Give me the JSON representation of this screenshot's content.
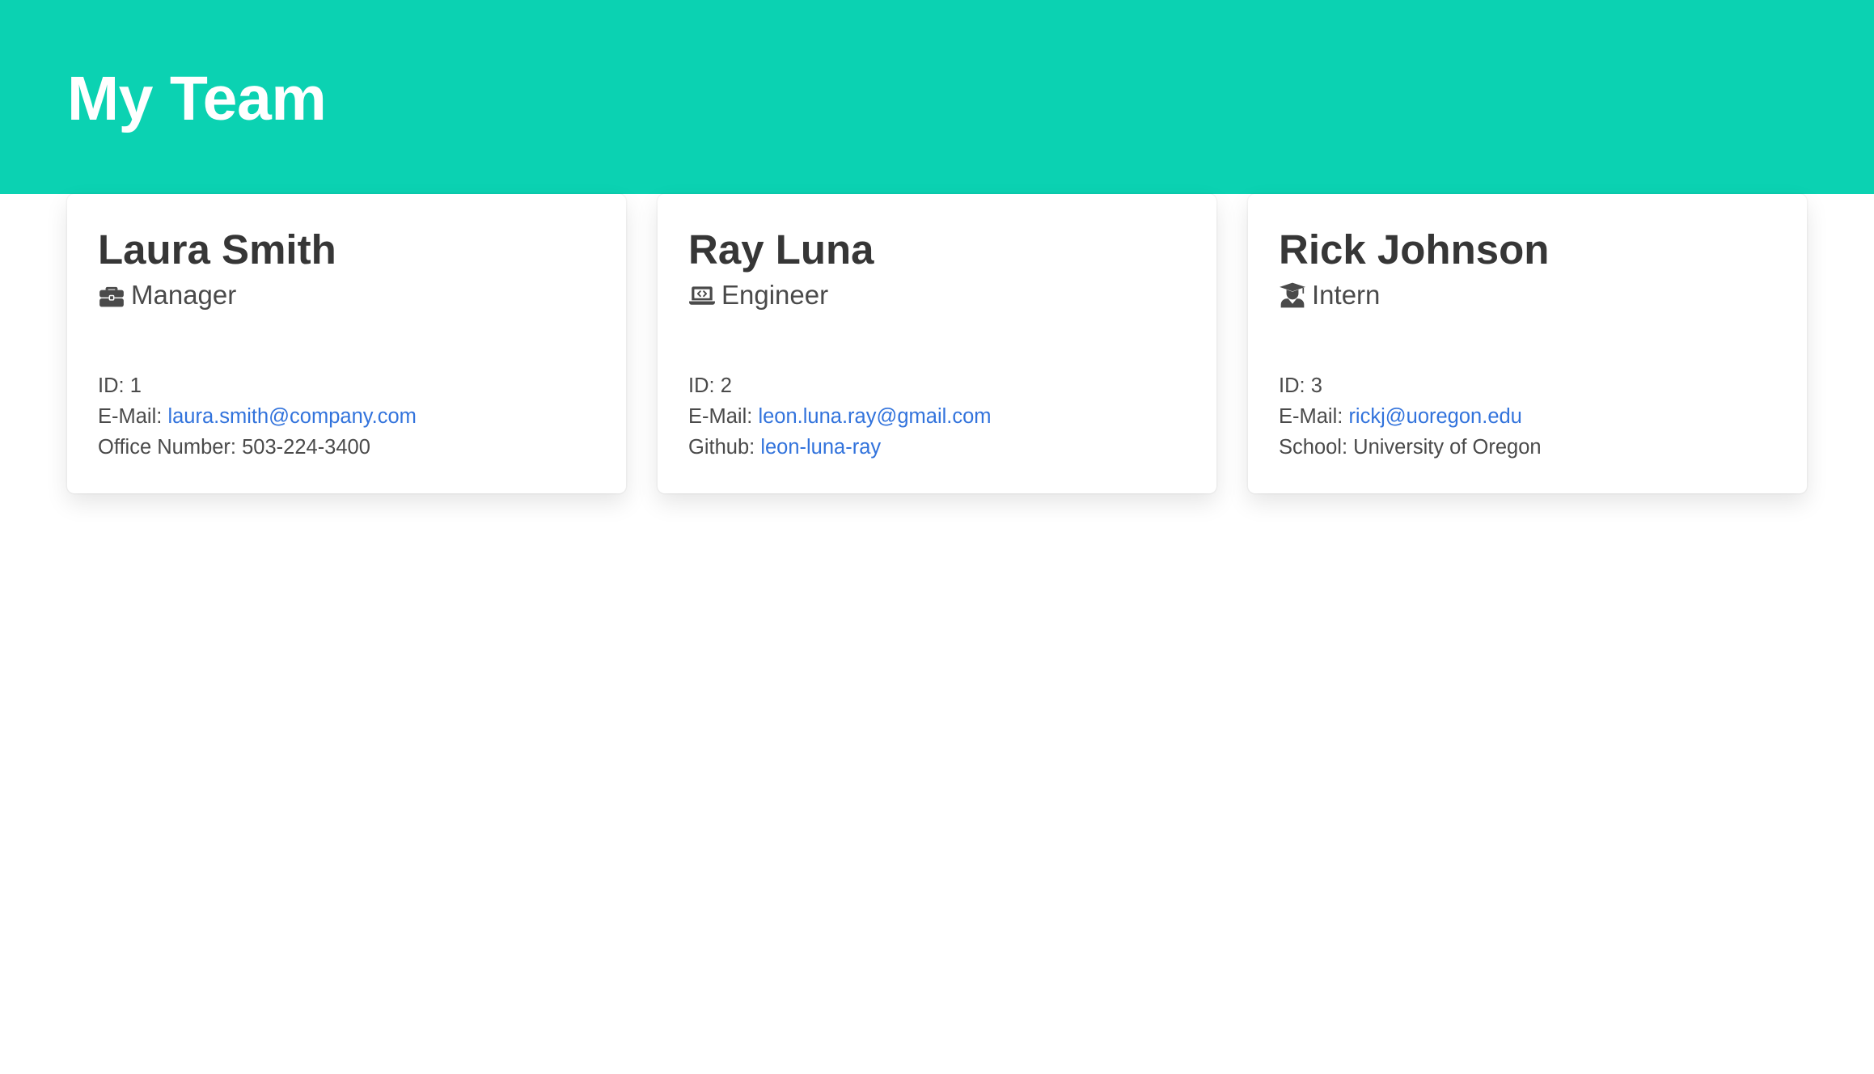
{
  "header": {
    "title": "My Team",
    "background_color": "#0bd2b2"
  },
  "employees": [
    {
      "name": "Laura Smith",
      "role": "Manager",
      "role_icon": "briefcase-icon",
      "id_label": "ID:",
      "id": "1",
      "email_label": "E-Mail:",
      "email": "laura.smith@company.com",
      "extra_label": "Office Number:",
      "extra_value": "503-224-3400"
    },
    {
      "name": "Ray Luna",
      "role": "Engineer",
      "role_icon": "laptop-code-icon",
      "id_label": "ID:",
      "id": "2",
      "email_label": "E-Mail:",
      "email": "leon.luna.ray@gmail.com",
      "extra_label": "Github:",
      "extra_value": "leon-luna-ray"
    },
    {
      "name": "Rick Johnson",
      "role": "Intern",
      "role_icon": "graduate-icon",
      "id_label": "ID:",
      "id": "3",
      "email_label": "E-Mail:",
      "email": "rickj@uoregon.edu",
      "extra_label": "School:",
      "extra_value": "University of Oregon"
    }
  ],
  "colors": {
    "accent": "#0bd2b2",
    "link": "#3273dc",
    "text": "#363636"
  }
}
